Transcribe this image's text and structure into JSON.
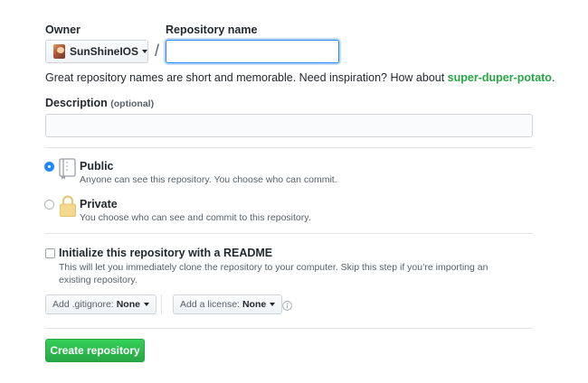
{
  "owner": {
    "label": "Owner",
    "name": "SunShineIOS"
  },
  "repo": {
    "label": "Repository name",
    "value": "",
    "separator": "/"
  },
  "inspiration": {
    "text": "Great repository names are short and memorable. Need inspiration? How about ",
    "suggestion": "super-duper-potato",
    "end": "."
  },
  "description": {
    "label": "Description",
    "optional": "(optional)",
    "value": ""
  },
  "visibility": {
    "public": {
      "title": "Public",
      "desc": "Anyone can see this repository. You choose who can commit.",
      "selected": true
    },
    "private": {
      "title": "Private",
      "desc": "You choose who can see and commit to this repository.",
      "selected": false
    }
  },
  "readme": {
    "label": "Initialize this repository with a README",
    "desc": "This will let you immediately clone the repository to your computer. Skip this step if you’re importing an existing repository.",
    "checked": false
  },
  "gitignore": {
    "label": "Add .gitignore:",
    "value": "None"
  },
  "license": {
    "label": "Add a license:",
    "value": "None"
  },
  "create_button": "Create repository",
  "colors": {
    "accent": "#2188ff",
    "success": "#28a745",
    "muted": "#586069"
  }
}
